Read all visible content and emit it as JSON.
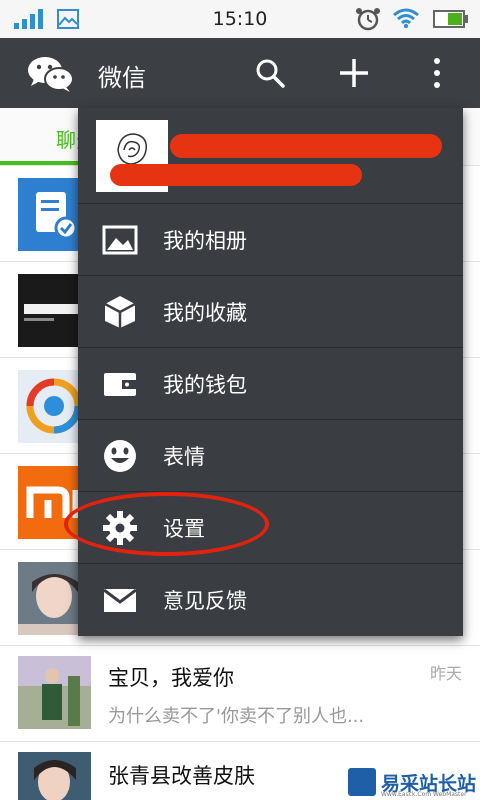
{
  "status_bar": {
    "time": "15:10"
  },
  "action_bar": {
    "title": "微信"
  },
  "tabs": {
    "chats": "聊天"
  },
  "menu": {
    "items": [
      {
        "label": "我的相册",
        "icon": "album-icon"
      },
      {
        "label": "我的收藏",
        "icon": "favorites-icon"
      },
      {
        "label": "我的钱包",
        "icon": "wallet-icon"
      },
      {
        "label": "表情",
        "icon": "emoji-icon"
      },
      {
        "label": "设置",
        "icon": "settings-icon"
      },
      {
        "label": "意见反馈",
        "icon": "feedback-icon"
      }
    ]
  },
  "chats": [
    {
      "name": "宝贝，我爱你",
      "time": "昨天",
      "preview": "为什么卖不了'你卖不了别人也..."
    },
    {
      "name": "张青县改善皮肤",
      "time": "",
      "preview": ""
    }
  ],
  "watermark": {
    "text": "易采站长站",
    "sub": "Www.Easck.Com WebMaster"
  },
  "colors": {
    "accent": "#45c01a",
    "action_bar": "#3c3f43",
    "menu_bg": "#3a3d41",
    "annotation": "#e1220f"
  }
}
